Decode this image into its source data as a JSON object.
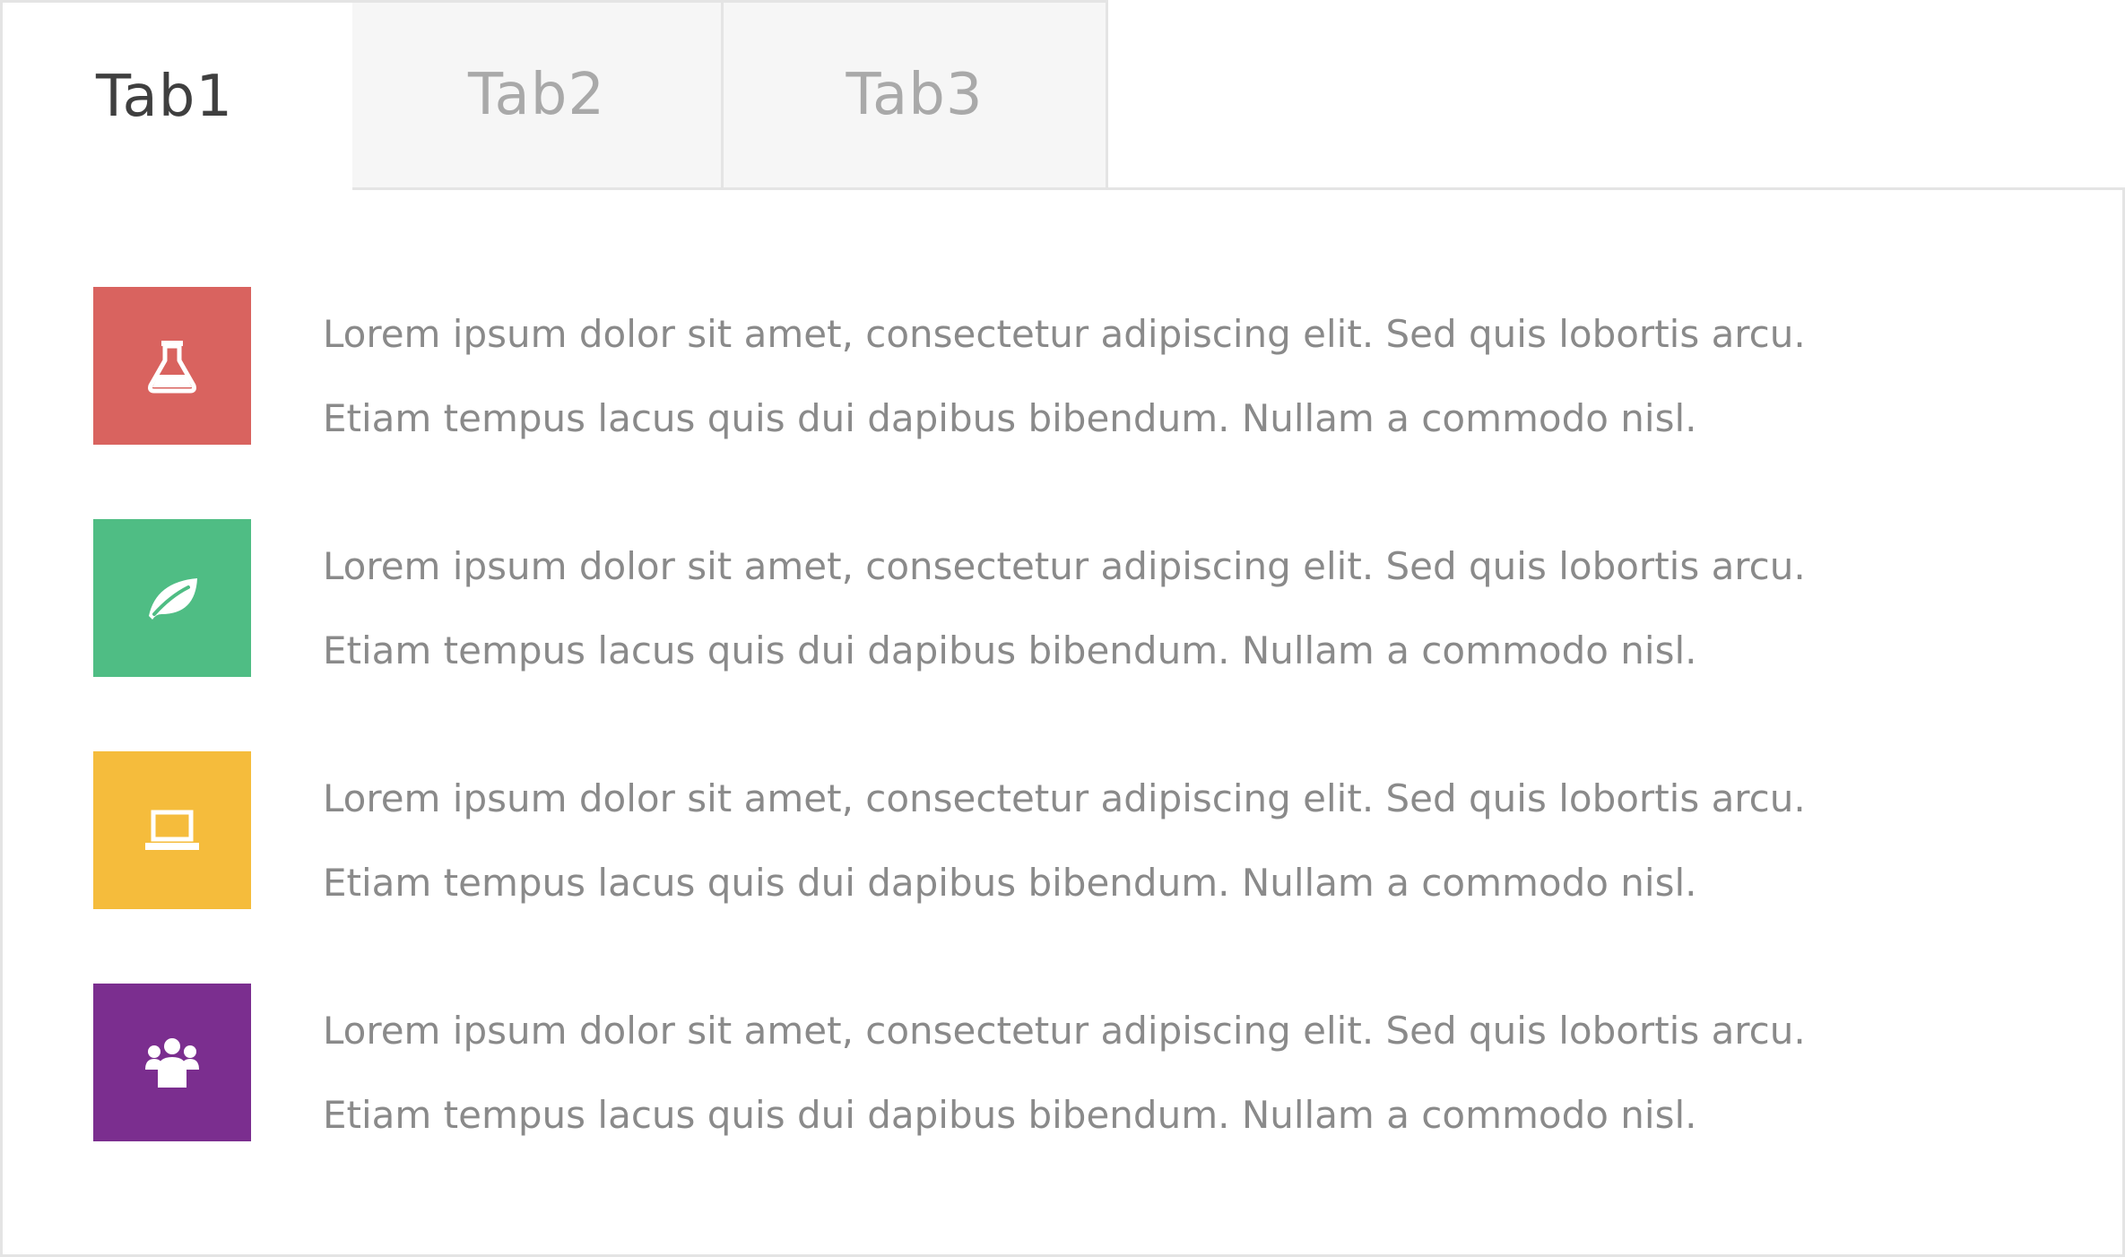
{
  "tabs": [
    {
      "label": "Tab1",
      "active": true
    },
    {
      "label": "Tab2",
      "active": false
    },
    {
      "label": "Tab3",
      "active": false
    }
  ],
  "items": [
    {
      "icon": "flask-icon",
      "color": "#d9635f",
      "line1": "Lorem ipsum dolor sit amet, consectetur adipiscing elit. Sed quis lobortis arcu.",
      "line2": "Etiam tempus lacus quis dui dapibus bibendum. Nullam a commodo nisl."
    },
    {
      "icon": "leaf-icon",
      "color": "#4fbd84",
      "line1": "Lorem ipsum dolor sit amet, consectetur adipiscing elit. Sed quis lobortis arcu.",
      "line2": "Etiam tempus lacus quis dui dapibus bibendum. Nullam a commodo nisl."
    },
    {
      "icon": "laptop-icon",
      "color": "#f5bc3c",
      "line1": "Lorem ipsum dolor sit amet, consectetur adipiscing elit. Sed quis lobortis arcu.",
      "line2": "Etiam tempus lacus quis dui dapibus bibendum. Nullam a commodo nisl."
    },
    {
      "icon": "users-icon",
      "color": "#7b2e8f",
      "line1": "Lorem ipsum dolor sit amet, consectetur adipiscing elit. Sed quis lobortis arcu.",
      "line2": "Etiam tempus lacus quis dui dapibus bibendum. Nullam a commodo nisl."
    }
  ]
}
